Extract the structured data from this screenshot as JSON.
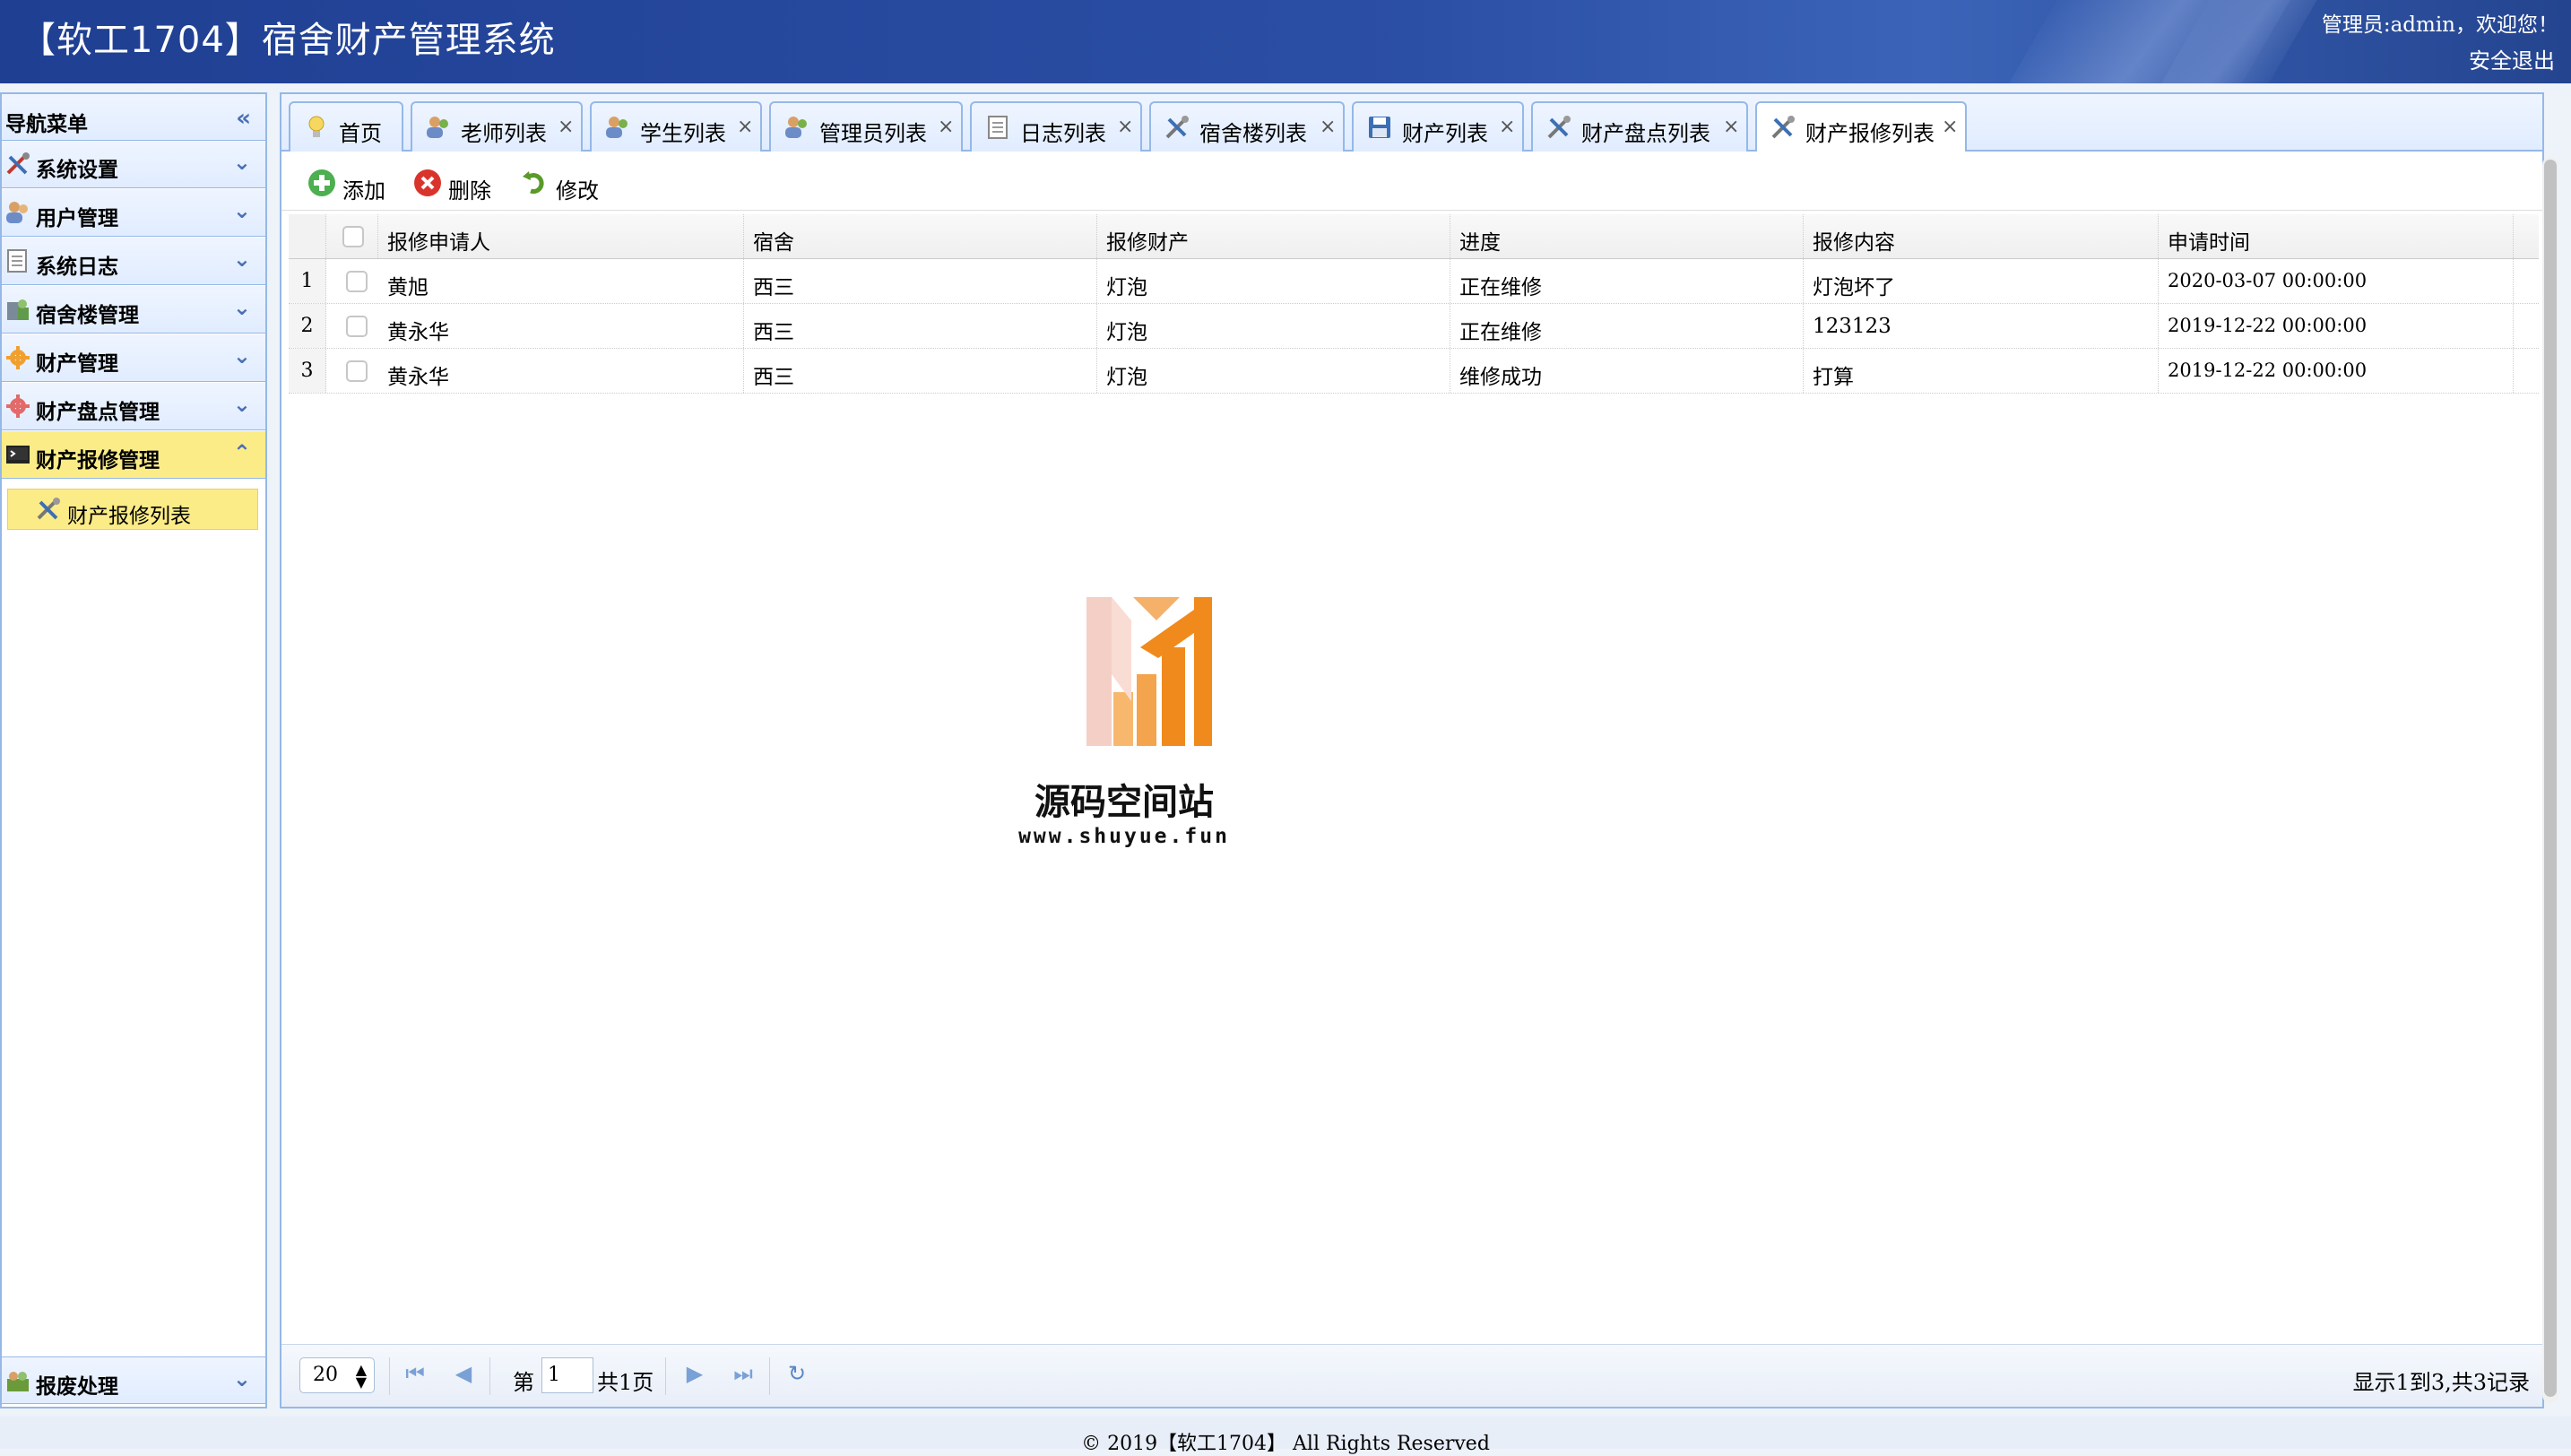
{
  "header": {
    "title": "【软工1704】宿舍财产管理系统",
    "welcome": "管理员:admin，欢迎您！",
    "logout": "安全退出"
  },
  "sidebar": {
    "title": "导航菜单",
    "items": [
      {
        "label": "系统设置"
      },
      {
        "label": "用户管理"
      },
      {
        "label": "系统日志"
      },
      {
        "label": "宿舍楼管理"
      },
      {
        "label": "财产管理"
      },
      {
        "label": "财产盘点管理"
      },
      {
        "label": "财产报修管理"
      }
    ],
    "sub_item": "财产报修列表",
    "bottom_item": "报废处理"
  },
  "tabs": [
    {
      "label": "首页",
      "icon": "lightbulb-icon"
    },
    {
      "label": "老师列表",
      "icon": "users-icon"
    },
    {
      "label": "学生列表",
      "icon": "users-icon"
    },
    {
      "label": "管理员列表",
      "icon": "users-icon"
    },
    {
      "label": "日志列表",
      "icon": "document-icon"
    },
    {
      "label": "宿舍楼列表",
      "icon": "tools-icon"
    },
    {
      "label": "财产列表",
      "icon": "floppy-icon"
    },
    {
      "label": "财产盘点列表",
      "icon": "tools-icon"
    },
    {
      "label": "财产报修列表",
      "icon": "tools-icon"
    }
  ],
  "toolbar": {
    "add": "添加",
    "delete": "删除",
    "edit": "修改"
  },
  "table": {
    "columns": [
      "报修申请人",
      "宿舍",
      "报修财产",
      "进度",
      "报修内容",
      "申请时间"
    ],
    "rows": [
      {
        "num": "1",
        "applicant": "黄旭",
        "dorm": "西三",
        "asset": "灯泡",
        "progress": "正在维修",
        "content": "灯泡坏了",
        "time": "2020-03-07 00:00:00"
      },
      {
        "num": "2",
        "applicant": "黄永华",
        "dorm": "西三",
        "asset": "灯泡",
        "progress": "正在维修",
        "content": "123123",
        "time": "2019-12-22 00:00:00"
      },
      {
        "num": "3",
        "applicant": "黄永华",
        "dorm": "西三",
        "asset": "灯泡",
        "progress": "维修成功",
        "content": "打算",
        "time": "2019-12-22 00:00:00"
      }
    ]
  },
  "watermark": {
    "title": "源码空间站",
    "url": "www.shuyue.fun"
  },
  "pager": {
    "page_size": "20",
    "page_prefix": "第",
    "page_value": "1",
    "page_total": "共1页",
    "summary": "显示1到3,共3记录"
  },
  "footer": "© 2019【软工1704】 All Rights Reserved",
  "colors": {
    "header_bg": "#2b4fa5",
    "panel_border": "#95b8e7",
    "active_menu": "#fbec88",
    "watermark_orange": "#f08a1c"
  }
}
